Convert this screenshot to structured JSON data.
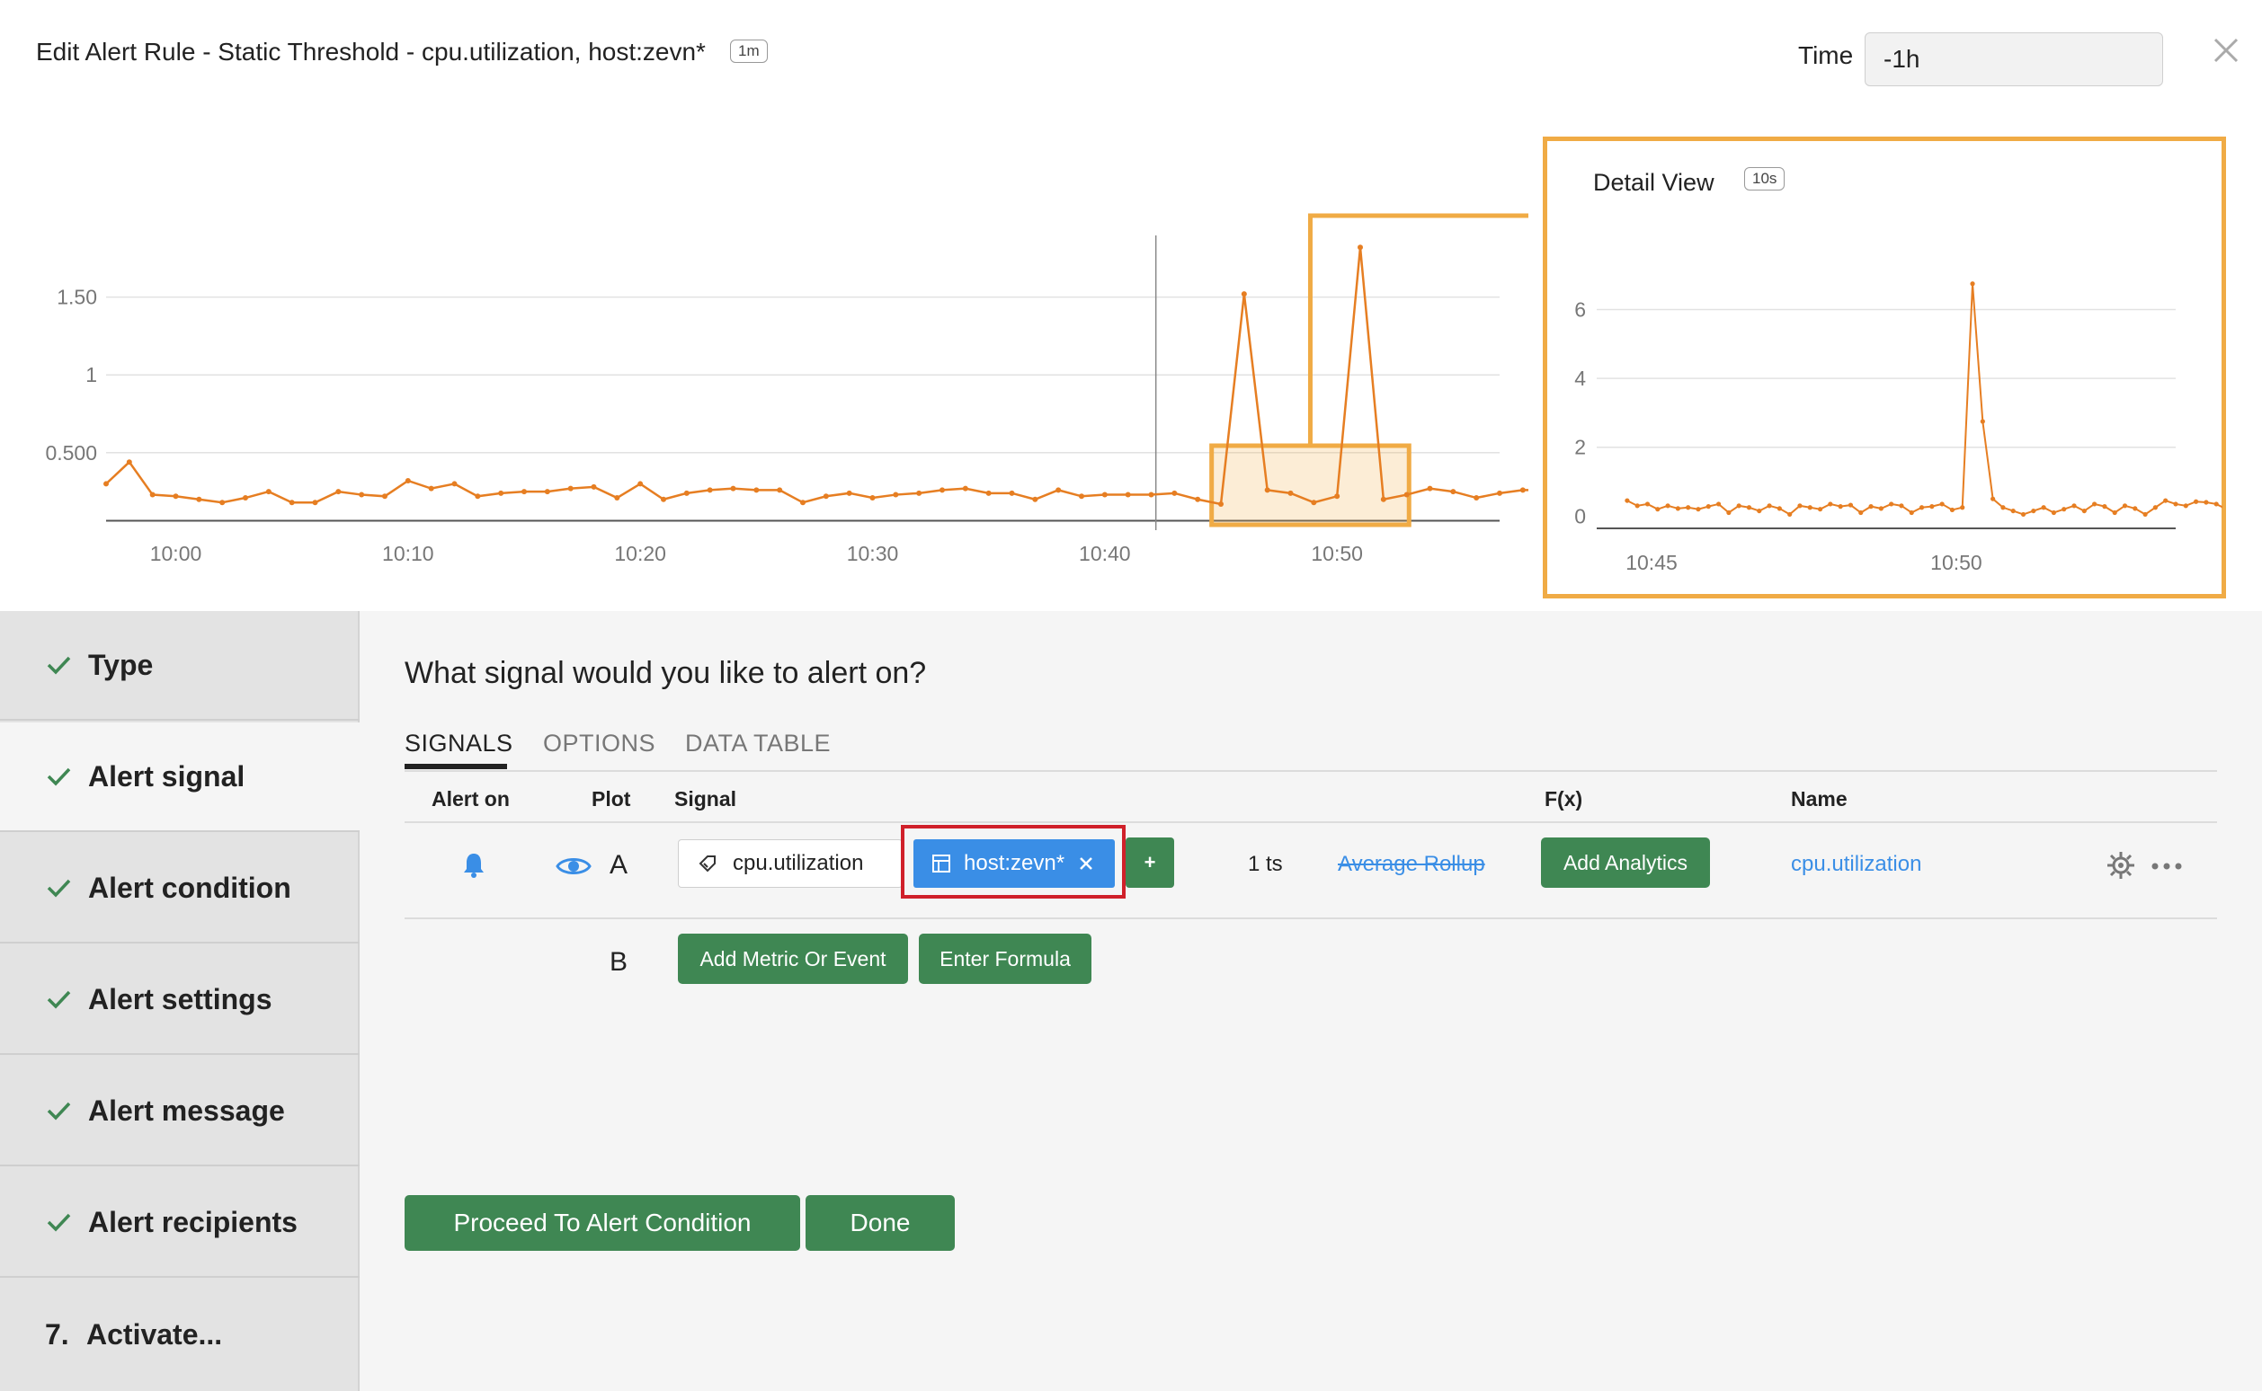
{
  "header": {
    "title": "Edit Alert Rule - Static Threshold - cpu.utilization, host:zevn*",
    "resolution": "1m",
    "time_label": "Time",
    "time_value": "-1h"
  },
  "icons": {
    "close": "close-icon",
    "check": "check-icon",
    "bell": "bell-icon",
    "eye": "eye-icon",
    "metric": "tag-icon",
    "filter": "filter-icon",
    "remove": "x-icon",
    "gear": "gear-icon",
    "more": "ellipsis-icon"
  },
  "colors": {
    "series": "#e67e22",
    "selection": "#f0ab45",
    "button_green": "#3f8753",
    "filter_blue": "#3a8ee6",
    "highlight_red": "#d0202a"
  },
  "chart_data": [
    {
      "type": "line",
      "y_ticks": [
        "1.50",
        "1",
        "0.500"
      ],
      "y_tick_values": [
        1.5,
        1,
        0.5
      ],
      "x_ticks": [
        "10:00",
        "10:10",
        "10:20",
        "10:30",
        "10:40",
        "10:50"
      ],
      "x_tick_minutes": [
        0,
        10,
        20,
        30,
        40,
        50
      ],
      "x_range_minutes": [
        -3,
        57
      ],
      "ylim": [
        0.06,
        1.85
      ],
      "grid": true,
      "start_time": "09:57",
      "interval_minutes": 1,
      "values": [
        0.3,
        0.44,
        0.23,
        0.22,
        0.2,
        0.18,
        0.21,
        0.25,
        0.18,
        0.18,
        0.25,
        0.23,
        0.22,
        0.32,
        0.27,
        0.3,
        0.22,
        0.24,
        0.25,
        0.25,
        0.27,
        0.28,
        0.21,
        0.3,
        0.2,
        0.24,
        0.26,
        0.27,
        0.26,
        0.26,
        0.18,
        0.22,
        0.24,
        0.21,
        0.23,
        0.24,
        0.26,
        0.27,
        0.24,
        0.24,
        0.2,
        0.26,
        0.22,
        0.23,
        0.23,
        0.23,
        0.24,
        0.2,
        0.17,
        1.52,
        0.26,
        0.24,
        0.18,
        0.22,
        1.82,
        0.2,
        0.23,
        0.27,
        0.25,
        0.21,
        0.24,
        0.26,
        0.26,
        0.22,
        0.21,
        0.17
      ],
      "time_marker_minute": 42.2,
      "selection_minutes": [
        44.6,
        53.1
      ]
    },
    {
      "type": "line",
      "title": "Detail View",
      "resolution": "10s",
      "y_ticks": [
        "0",
        "2",
        "4",
        "6"
      ],
      "y_tick_values": [
        0,
        2,
        4,
        6
      ],
      "x_ticks": [
        "10:45",
        "10:50"
      ],
      "x_tick_minutes": [
        45,
        50
      ],
      "x_range_minutes": [
        44.1,
        53.6
      ],
      "ylim": [
        -0.2,
        6.9
      ],
      "grid": true,
      "start_minute": 44.6,
      "interval_seconds": 10,
      "values": [
        0.45,
        0.3,
        0.35,
        0.2,
        0.3,
        0.22,
        0.25,
        0.2,
        0.28,
        0.35,
        0.1,
        0.3,
        0.25,
        0.15,
        0.3,
        0.22,
        0.05,
        0.3,
        0.25,
        0.2,
        0.35,
        0.28,
        0.32,
        0.1,
        0.28,
        0.22,
        0.35,
        0.3,
        0.1,
        0.25,
        0.28,
        0.35,
        0.18,
        0.25,
        6.75,
        2.75,
        0.5,
        0.25,
        0.15,
        0.05,
        0.15,
        0.25,
        0.1,
        0.2,
        0.3,
        0.15,
        0.35,
        0.28,
        0.1,
        0.3,
        0.22,
        0.05,
        0.25,
        0.45,
        0.35,
        0.3,
        0.42,
        0.4,
        0.35,
        0.2,
        0.4,
        0.25,
        0.3,
        0.28,
        0.15,
        0.25,
        0.3,
        0.55,
        0.05,
        0.5,
        0.35,
        0.25,
        0.3,
        0.2,
        0.35,
        0.25,
        0.32,
        0.3,
        0.1,
        0.65,
        0.1,
        0.3,
        0.2,
        0.35,
        0.25,
        0.45
      ]
    }
  ],
  "sidebar": {
    "items": [
      {
        "label": "Type",
        "done": true
      },
      {
        "label": "Alert signal",
        "done": true,
        "active": true
      },
      {
        "label": "Alert condition",
        "done": true
      },
      {
        "label": "Alert settings",
        "done": true
      },
      {
        "label": "Alert message",
        "done": true
      },
      {
        "label": "Alert recipients",
        "done": true
      },
      {
        "label": "Activate...",
        "step": "7."
      }
    ]
  },
  "main": {
    "question": "What signal would you like to alert on?",
    "tabs": [
      {
        "label": "SIGNALS",
        "active": true
      },
      {
        "label": "OPTIONS"
      },
      {
        "label": "DATA TABLE"
      }
    ],
    "columns": {
      "alert_on": "Alert on",
      "plot": "Plot",
      "signal": "Signal",
      "fx": "F(x)",
      "name": "Name"
    },
    "rows": [
      {
        "letter": "A",
        "metric": "cpu.utilization",
        "filter": "host:zevn*",
        "add_button": "+",
        "ts_count": "1 ts",
        "rollup": "Average Rollup",
        "analytics_button": "Add Analytics",
        "name": "cpu.utilization"
      },
      {
        "letter": "B",
        "add_metric_button": "Add Metric Or Event",
        "formula_button": "Enter Formula"
      }
    ],
    "proceed_button": "Proceed To Alert Condition",
    "done_button": "Done"
  }
}
